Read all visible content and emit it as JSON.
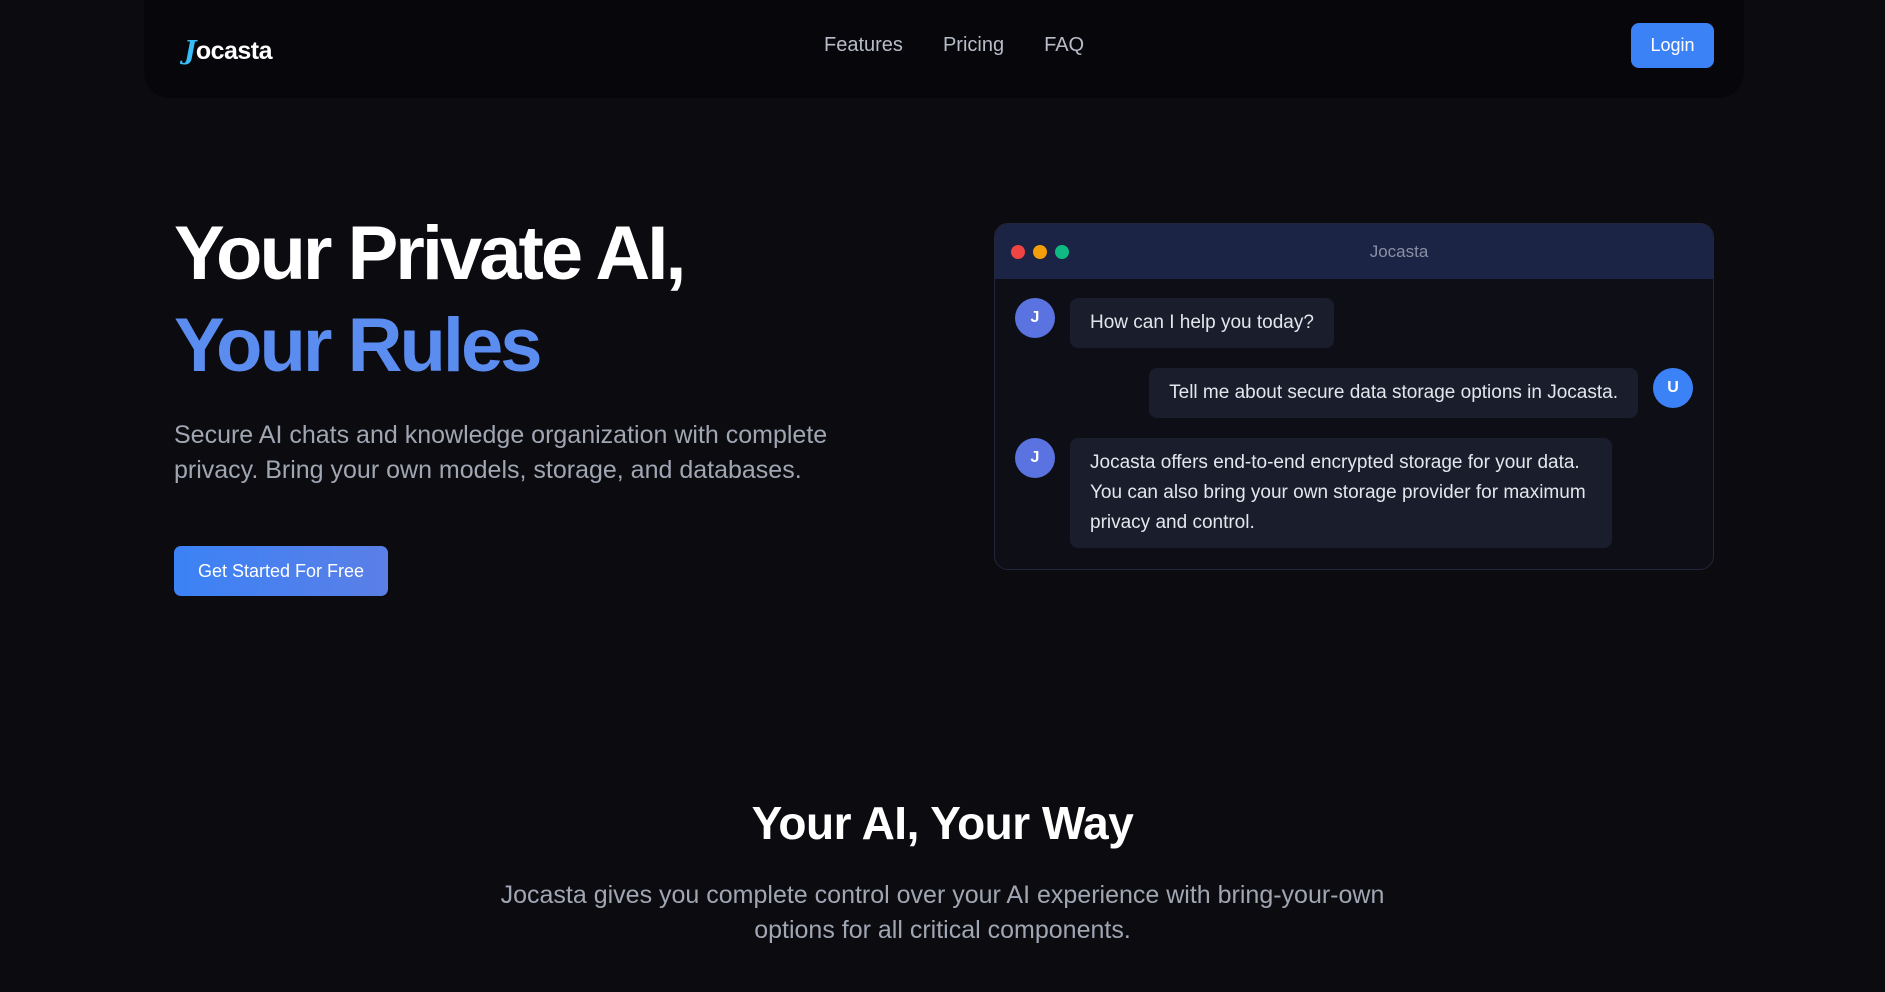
{
  "nav": {
    "logo_initial": "J",
    "logo_rest": "ocasta",
    "links": [
      "Features",
      "Pricing",
      "FAQ"
    ],
    "login_label": "Login"
  },
  "hero": {
    "title_line1": "Your Private AI,",
    "title_line2": "Your Rules",
    "subtitle": "Secure AI chats and knowledge organization with complete privacy. Bring your own models, storage, and databases.",
    "cta_label": "Get Started For Free"
  },
  "chat": {
    "window_title": "Jocasta",
    "assistant_avatar": "J",
    "user_avatar": "U",
    "messages": [
      "How can I help you today?",
      "Tell me about secure data storage options in Jocasta.",
      "Jocasta offers end-to-end encrypted storage for your data. You can also bring your own storage provider for maximum privacy and control."
    ]
  },
  "section2": {
    "title": "Your AI, Your Way",
    "subtitle": "Jocasta gives you complete control over your AI experience with bring-your-own options for all critical components."
  },
  "colors": {
    "accent": "#3b82f6",
    "highlight": "#5b8cf0",
    "background": "#0b0b10"
  }
}
